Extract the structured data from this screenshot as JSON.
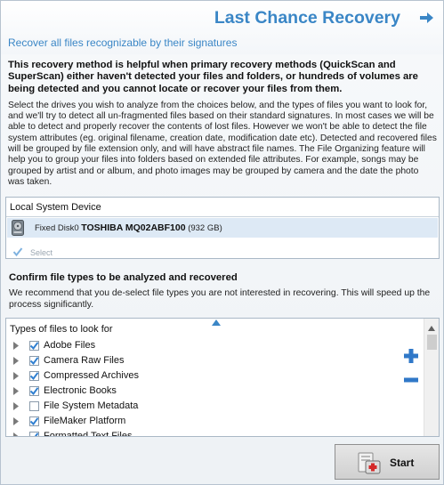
{
  "header": {
    "title": "Last Chance Recovery",
    "subtitle": "Recover all files recognizable by their signatures"
  },
  "description": {
    "bold": "This recovery method is helpful when primary recovery methods (QuickScan and SuperScan) either haven't detected your files and folders, or hundreds of volumes are being detected and you cannot locate or recover your files from them.",
    "normal": "Select the drives you wish to analyze from the choices below, and the types of files you want to look for, and we'll try to detect all un-fragmented files based on their standard signatures. In most cases we will be able to detect and properly recover the contents of lost files. However we won't be able to detect the file system attributes (eg. original filename, creation date, modification date etc). Detected and recovered files will be grouped by file extension only, and will have abstract file names. The File Organizing feature will help you to group your files into folders based on extended file attributes. For example, songs may be grouped by artist and or album, and photo images may be grouped by camera and the date the photo was taken."
  },
  "devices": {
    "header": "Local System Device",
    "disk_prefix": "Fixed Disk0",
    "disk_model": "TOSHIBA MQ02ABF100",
    "disk_size": "(932 GB)",
    "select_label": "Select"
  },
  "confirm": {
    "title": "Confirm file types to be analyzed and recovered",
    "desc": "We recommend that you de-select file types you are not interested in recovering. This will speed up the process significantly."
  },
  "file_types": {
    "header": "Types of files to look for",
    "items": [
      {
        "label": "Adobe Files",
        "checked": true
      },
      {
        "label": "Camera Raw Files",
        "checked": true
      },
      {
        "label": "Compressed Archives",
        "checked": true
      },
      {
        "label": "Electronic Books",
        "checked": true
      },
      {
        "label": "File System Metadata",
        "checked": false
      },
      {
        "label": "FileMaker Platform",
        "checked": true
      },
      {
        "label": "Formatted Text Files",
        "checked": true
      }
    ]
  },
  "footer": {
    "start_label": "Start"
  },
  "colors": {
    "accent": "#3a86c6",
    "check": "#2f7fd1",
    "selected_row": "#dde9f5"
  }
}
